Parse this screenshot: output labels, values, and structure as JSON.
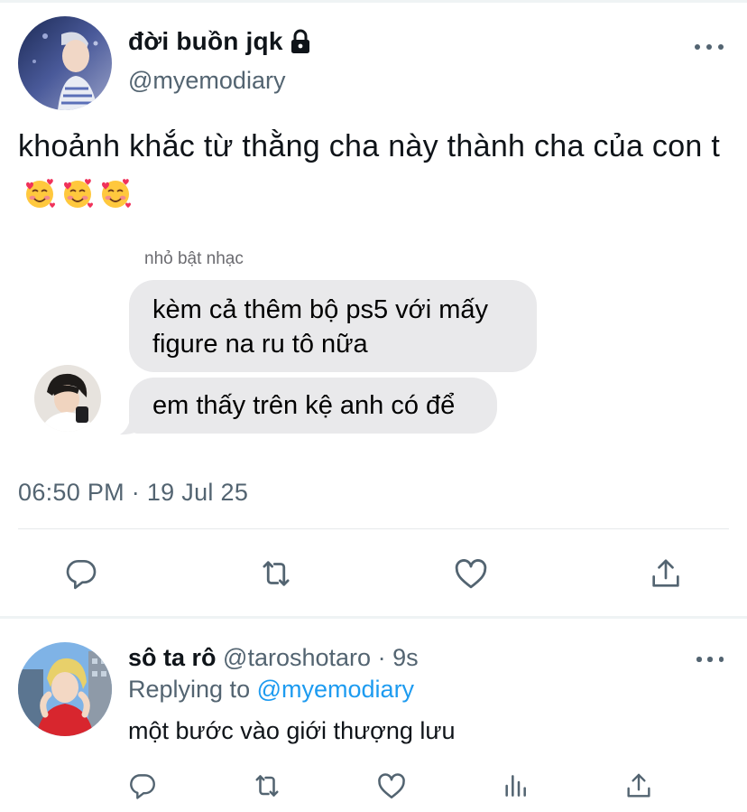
{
  "tweet": {
    "display_name": "đời buồn jqk",
    "handle": "@myemodiary",
    "text": "khoảnh khắc từ thằng cha này thành cha của con t",
    "timestamp": "06:50 PM · 19 Jul 25",
    "emoji": [
      "smiling-face-with-hearts",
      "smiling-face-with-hearts",
      "smiling-face-with-hearts"
    ]
  },
  "chat": {
    "sender_label": "nhỏ bật nhạc",
    "message_1": "kèm cả thêm bộ ps5 với mấy figure na ru tô nữa",
    "message_2": "em thấy trên kệ anh có để",
    "bubble_color": "#e9e9eb"
  },
  "reply": {
    "name": "sô ta rô",
    "handle": "@taroshotaro",
    "separator": "·",
    "time": "9s",
    "replying_prefix": "Replying to",
    "replying_to": "@myemodiary",
    "text": "một bước vào giới thượng lưu"
  },
  "colors": {
    "text": "#0f1419",
    "secondary": "#536471",
    "accent": "#1d9bf0",
    "divider": "#eff3f4"
  },
  "icons": {
    "main_actions": [
      "reply-icon",
      "retweet-icon",
      "like-icon",
      "share-icon"
    ],
    "reply_actions": [
      "reply-icon",
      "retweet-icon",
      "like-icon",
      "analytics-icon",
      "share-icon"
    ]
  }
}
